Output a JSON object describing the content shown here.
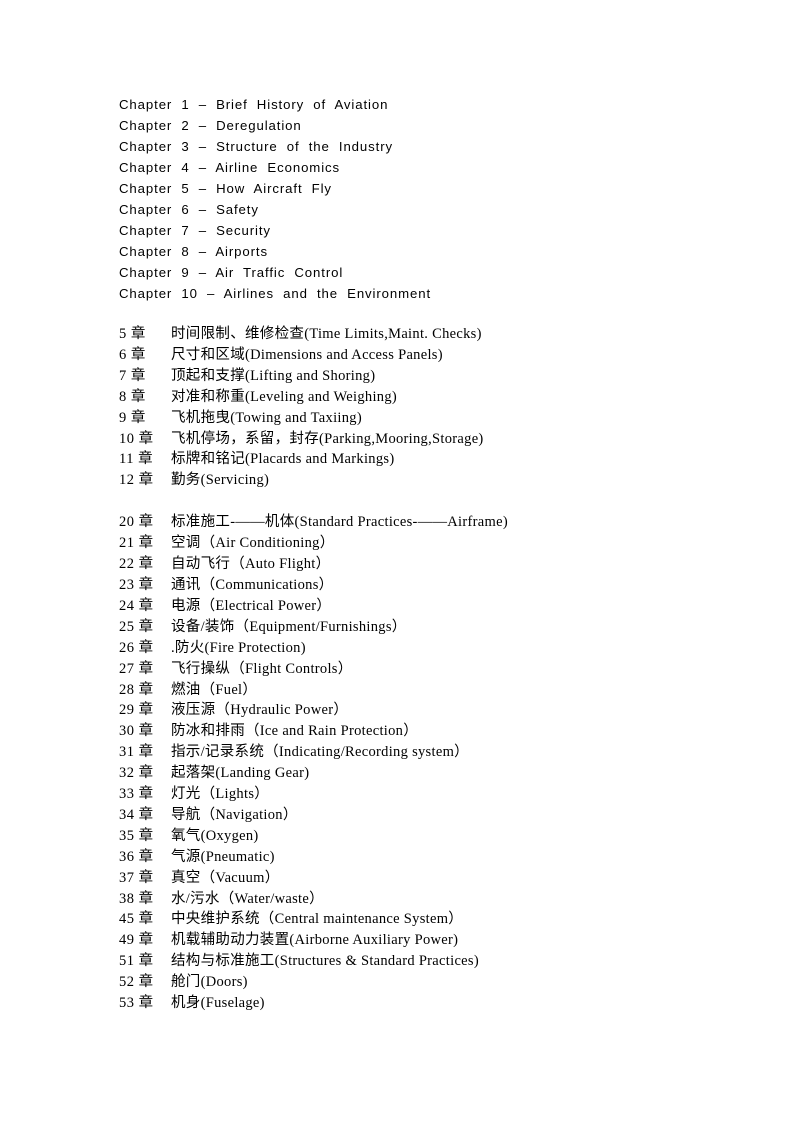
{
  "document": {
    "chapters_en": [
      "Chapter  1  –  Brief  History  of  Aviation",
      "Chapter  2  –  Deregulation",
      "Chapter  3  –  Structure  of  the  Industry",
      "Chapter  4  –  Airline  Economics",
      "Chapter  5  –  How  Aircraft  Fly",
      "Chapter  6  –  Safety",
      "Chapter  7  –  Security",
      "Chapter  8  –  Airports",
      "Chapter  9  –  Air  Traffic  Control",
      "Chapter  10  –  Airlines  and  the  Environment"
    ],
    "ata_group_1": [
      {
        "num": "5 章",
        "title": "时间限制、维修检查(Time Limits,Maint. Checks)"
      },
      {
        "num": "6 章",
        "title": "尺寸和区域(Dimensions and Access Panels)"
      },
      {
        "num": "7 章",
        "title": "顶起和支撑(Lifting and Shoring)"
      },
      {
        "num": "8 章",
        "title": "对准和称重(Leveling and Weighing)"
      },
      {
        "num": "9 章",
        "title": "飞机拖曳(Towing and Taxiing)"
      },
      {
        "num": "10 章",
        "title": "飞机停场，系留，封存(Parking,Mooring,Storage)"
      },
      {
        "num": "11 章",
        "title": "标牌和铭记(Placards and Markings)"
      },
      {
        "num": "12 章",
        "title": "勤务(Servicing)"
      }
    ],
    "ata_group_2": [
      {
        "num": "20 章",
        "title": "标准施工-――机体(Standard Practices-――Airframe)"
      },
      {
        "num": "21 章",
        "title": "空调（Air Conditioning）"
      },
      {
        "num": "22 章",
        "title": "自动飞行（Auto Flight）"
      },
      {
        "num": "23 章",
        "title": "通讯（Communications）"
      },
      {
        "num": "24 章",
        "title": "电源（Electrical Power）"
      },
      {
        "num": "25 章",
        "title": "设备/装饰（Equipment/Furnishings）"
      },
      {
        "num": "26 章",
        "title": ".防火(Fire Protection)"
      },
      {
        "num": "27 章",
        "title": "飞行操纵（Flight Controls）"
      },
      {
        "num": "28 章",
        "title": "燃油（Fuel）"
      },
      {
        "num": "29 章",
        "title": "液压源（Hydraulic Power）"
      },
      {
        "num": "30 章",
        "title": "防冰和排雨（Ice and Rain Protection）"
      },
      {
        "num": "31 章",
        "title": "指示/记录系统（Indicating/Recording system）"
      },
      {
        "num": "32 章",
        "title": "起落架(Landing Gear)"
      },
      {
        "num": "33 章",
        "title": "灯光（Lights）"
      },
      {
        "num": "34 章",
        "title": "导航（Navigation）"
      },
      {
        "num": "35 章",
        "title": "氧气(Oxygen)"
      },
      {
        "num": "36 章",
        "title": "气源(Pneumatic)"
      },
      {
        "num": "37 章",
        "title": "真空（Vacuum）"
      },
      {
        "num": "38 章",
        "title": "水/污水（Water/waste）"
      },
      {
        "num": "45 章",
        "title": "中央维护系统（Central maintenance System）"
      },
      {
        "num": "49 章",
        "title": "机载辅助动力装置(Airborne Auxiliary Power)"
      },
      {
        "num": "51 章",
        "title": "结构与标准施工(Structures & Standard Practices)"
      },
      {
        "num": "52 章",
        "title": "舱门(Doors)"
      },
      {
        "num": "53 章",
        "title": "机身(Fuselage)"
      }
    ]
  }
}
